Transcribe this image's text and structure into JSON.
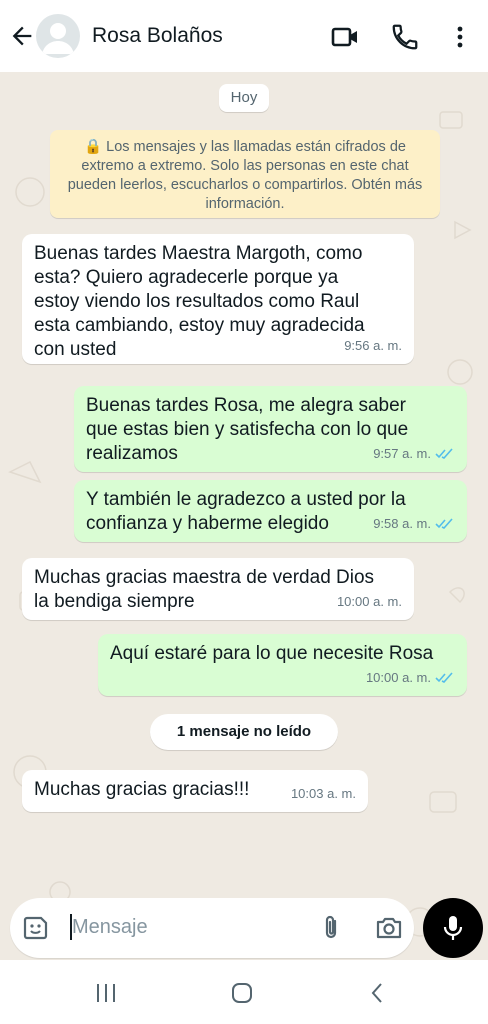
{
  "header": {
    "contact_name": "Rosa Bolaños"
  },
  "chat": {
    "date_label": "Hoy",
    "encryption_notice": "🔒 Los mensajes y las llamadas están cifrados de extremo a extremo. Solo las personas en este chat pueden leerlos, escucharlos o compartirlos. Obtén más información.",
    "unread_label": "1 mensaje no leído",
    "messages": [
      {
        "direction": "in",
        "text": "Buenas tardes Maestra Margoth, como\nesta? Quiero agradecerle porque ya\nestoy viendo los resultados como Raul\nesta cambiando, estoy muy agradecida\ncon usted",
        "time": "9:56 a. m."
      },
      {
        "direction": "out",
        "text": "Buenas tardes Rosa, me alegra saber\nque estas bien y satisfecha con lo que\nrealizamos",
        "time": "9:57 a. m.",
        "read": true
      },
      {
        "direction": "out",
        "text": "Y también le agradezco a usted por la\nconfianza y haberme elegido",
        "time": "9:58 a. m.",
        "read": true
      },
      {
        "direction": "in",
        "text": "Muchas gracias maestra de verdad Dios\nla  bendiga siempre",
        "time": "10:00 a. m."
      },
      {
        "direction": "out",
        "text": "Aquí estaré para lo que necesite Rosa",
        "time": "10:00 a. m.",
        "read": true
      },
      {
        "direction": "in",
        "text": "Muchas gracias gracias!!!",
        "time": "10:03 a. m."
      }
    ]
  },
  "input": {
    "placeholder": "Mensaje"
  },
  "colors": {
    "outgoing_bubble": "#d9fdd3",
    "incoming_bubble": "#ffffff",
    "read_ticks": "#53bdeb",
    "notice_bg": "#fdf0c8"
  }
}
